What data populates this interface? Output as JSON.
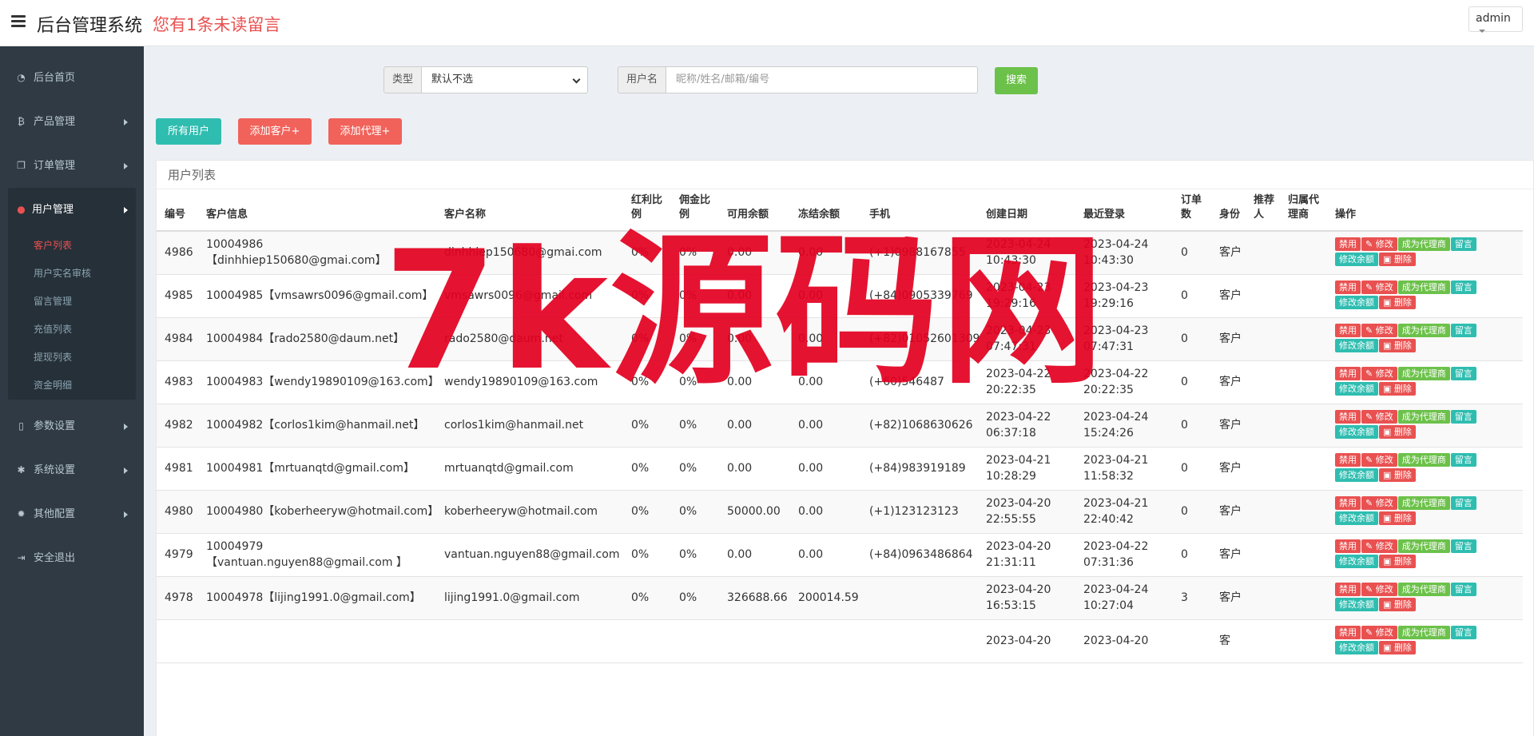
{
  "header": {
    "brand": "后台管理系统",
    "notice": "您有1条未读留言",
    "user": "admin"
  },
  "sidebar": {
    "items": [
      {
        "label": "后台首页",
        "icon": "dashboard-icon"
      },
      {
        "label": "产品管理",
        "icon": "bitcoin-icon"
      },
      {
        "label": "订单管理",
        "icon": "copy-icon"
      },
      {
        "label": "用户管理",
        "icon": "user-icon"
      },
      {
        "label": "参数设置",
        "icon": "file-icon"
      },
      {
        "label": "系统设置",
        "icon": "cogs-icon"
      },
      {
        "label": "其他配置",
        "icon": "gear-icon"
      },
      {
        "label": "安全退出",
        "icon": "sign-out-icon"
      }
    ],
    "sub_items": [
      "客户列表",
      "用户实名审核",
      "留言管理",
      "充值列表",
      "提现列表",
      "资金明细"
    ]
  },
  "filter": {
    "type_label": "类型",
    "type_value": "默认不选",
    "user_label": "用户名",
    "user_placeholder": "昵称/姓名/邮箱/编号",
    "search_label": "搜索"
  },
  "actions": {
    "all_users": "所有用户",
    "add_customer": "添加客户+",
    "add_agent": "添加代理+"
  },
  "panel": {
    "title": "用户列表"
  },
  "table": {
    "headers": [
      "编号",
      "客户信息",
      "客户名称",
      "红利比例",
      "佣金比例",
      "可用余额",
      "冻结余额",
      "手机",
      "创建日期",
      "最近登录",
      "订单数",
      "身份",
      "推荐人",
      "归属代理商",
      "操作"
    ],
    "ops": [
      "禁用",
      "修改",
      "成为代理商",
      "留言",
      "修改余额",
      "删除"
    ],
    "rows": [
      {
        "id": "4986",
        "info": "10004986【dinhhiep150680@gmai.com】",
        "name": "dinhhiep150680@gmai.com",
        "bonus": "0%",
        "commission": "0%",
        "available": "0.00",
        "frozen": "0.00",
        "phone": "(+1)0988167855",
        "created": "2023-04-24 10:43:30",
        "last_login": "2023-04-24 10:43:30",
        "orders": "0",
        "role": "客户",
        "referrer": "",
        "agent": ""
      },
      {
        "id": "4985",
        "info": "10004985【vmsawrs0096@gmail.com】",
        "name": "vmsawrs0096@gmail.com",
        "bonus": "0%",
        "commission": "0%",
        "available": "0.00",
        "frozen": "0.00",
        "phone": "(+84)0905339769",
        "created": "2023-04-23 19:29:16",
        "last_login": "2023-04-23 19:29:16",
        "orders": "0",
        "role": "客户",
        "referrer": "",
        "agent": ""
      },
      {
        "id": "4984",
        "info": "10004984【rado2580@daum.net】",
        "name": "rado2580@daum.net",
        "bonus": "0%",
        "commission": "0%",
        "available": "0.00",
        "frozen": "0.00",
        "phone": "(+82)01052601309",
        "created": "2023-04-23 07:47:31",
        "last_login": "2023-04-23 07:47:31",
        "orders": "0",
        "role": "客户",
        "referrer": "",
        "agent": ""
      },
      {
        "id": "4983",
        "info": "10004983【wendy19890109@163.com】",
        "name": "wendy19890109@163.com",
        "bonus": "0%",
        "commission": "0%",
        "available": "0.00",
        "frozen": "0.00",
        "phone": "(+60)546487",
        "created": "2023-04-22 20:22:35",
        "last_login": "2023-04-22 20:22:35",
        "orders": "0",
        "role": "客户",
        "referrer": "",
        "agent": ""
      },
      {
        "id": "4982",
        "info": "10004982【corlos1kim@hanmail.net】",
        "name": "corlos1kim@hanmail.net",
        "bonus": "0%",
        "commission": "0%",
        "available": "0.00",
        "frozen": "0.00",
        "phone": "(+82)1068630626",
        "created": "2023-04-22 06:37:18",
        "last_login": "2023-04-24 15:24:26",
        "orders": "0",
        "role": "客户",
        "referrer": "",
        "agent": ""
      },
      {
        "id": "4981",
        "info": "10004981【mrtuanqtd@gmail.com】",
        "name": "mrtuanqtd@gmail.com",
        "bonus": "0%",
        "commission": "0%",
        "available": "0.00",
        "frozen": "0.00",
        "phone": "(+84)983919189",
        "created": "2023-04-21 10:28:29",
        "last_login": "2023-04-21 11:58:32",
        "orders": "0",
        "role": "客户",
        "referrer": "",
        "agent": ""
      },
      {
        "id": "4980",
        "info": "10004980【koberheeryw@hotmail.com】",
        "name": "koberheeryw@hotmail.com",
        "bonus": "0%",
        "commission": "0%",
        "available": "50000.00",
        "frozen": "0.00",
        "phone": "(+1)123123123",
        "created": "2023-04-20 22:55:55",
        "last_login": "2023-04-21 22:40:42",
        "orders": "0",
        "role": "客户",
        "referrer": "",
        "agent": ""
      },
      {
        "id": "4979",
        "info": "10004979【vantuan.nguyen88@gmail.com 】",
        "name": "vantuan.nguyen88@gmail.com",
        "bonus": "0%",
        "commission": "0%",
        "available": "0.00",
        "frozen": "0.00",
        "phone": "(+84)0963486864",
        "created": "2023-04-20 21:31:11",
        "last_login": "2023-04-22 07:31:36",
        "orders": "0",
        "role": "客户",
        "referrer": "",
        "agent": ""
      },
      {
        "id": "4978",
        "info": "10004978【lijing1991.0@gmail.com】",
        "name": "lijing1991.0@gmail.com",
        "bonus": "0%",
        "commission": "0%",
        "available": "326688.66",
        "frozen": "200014.59",
        "phone": "",
        "created": "2023-04-20 16:53:15",
        "last_login": "2023-04-24 10:27:04",
        "orders": "3",
        "role": "客户",
        "referrer": "",
        "agent": ""
      },
      {
        "id": "",
        "info": "",
        "name": "",
        "bonus": "",
        "commission": "",
        "available": "",
        "frozen": "",
        "phone": "",
        "created": "2023-04-20",
        "last_login": "2023-04-20",
        "orders": "",
        "role": "客",
        "referrer": "",
        "agent": ""
      }
    ]
  },
  "watermark": "7k源码网",
  "colors": {
    "danger": "#e95151",
    "success": "#6cc14a",
    "teal": "#2fbdb0",
    "sidebar": "#2f3a45"
  }
}
